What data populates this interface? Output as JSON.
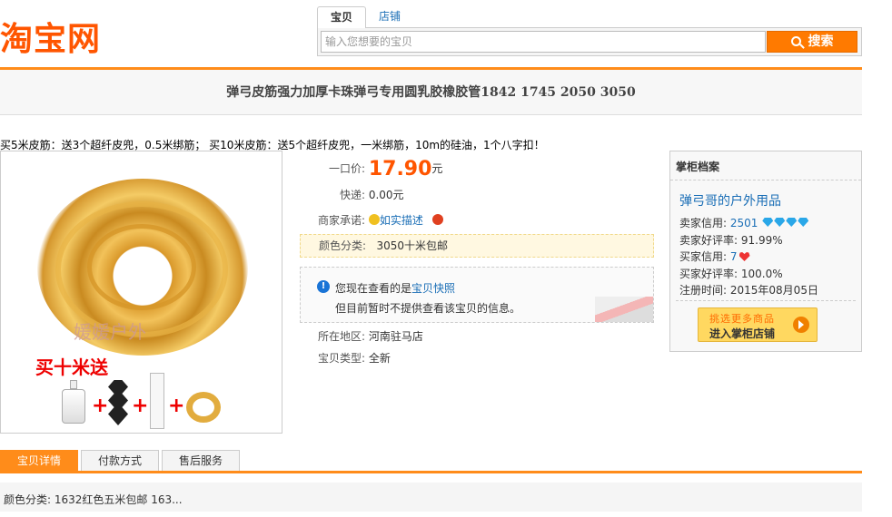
{
  "header": {
    "logo": "淘宝网",
    "search_tabs": [
      "宝贝",
      "店铺"
    ],
    "search_placeholder": "输入您想要的宝贝",
    "search_button": "搜索"
  },
  "product": {
    "title": "弹弓皮筋强力加厚卡珠弹弓专用圆乳胶橡胶管1842 1745 2050 3050",
    "promo": "买5米皮筋：送3个超纤皮兜，0.5米绑筋； 买10米皮筋：送5个超纤皮兜，一米绑筋，10m的硅油，1个八字扣！",
    "image_watermark": "媛媛户外",
    "image_caption": "买十米送",
    "price_label": "一口价:",
    "price": "17.90",
    "price_unit": "元",
    "shipping_label": "快递:",
    "shipping_value": "0.00元",
    "promise_label": "商家承诺:",
    "promise_value": "如实描述",
    "color_label": "颜色分类:",
    "color_value": "3050十米包邮",
    "notice_line1_prefix": "您现在查看的是",
    "notice_line1_link": "宝贝快照",
    "notice_line2": "但目前暂时不提供查看该宝贝的信息。",
    "location_label": "所在地区:",
    "location_value": "河南驻马店",
    "type_label": "宝贝类型:",
    "type_value": "全新"
  },
  "seller": {
    "heading": "掌柜档案",
    "shop_name": "弹弓哥的户外用品",
    "seller_credit_label": "卖家信用:",
    "seller_credit_value": "2501",
    "seller_rate_label": "卖家好评率:",
    "seller_rate_value": "91.99%",
    "buyer_credit_label": "买家信用:",
    "buyer_credit_value": "7",
    "buyer_rate_label": "买家好评率:",
    "buyer_rate_value": "100.0%",
    "reg_label": "注册时间:",
    "reg_value": "2015年08月05日",
    "button_line1": "挑选更多商品",
    "button_line2": "进入掌柜店铺"
  },
  "detail_tabs": [
    "宝贝详情",
    "付款方式",
    "售后服务"
  ],
  "detail_text": "颜色分类: 1632红色五米包邮 163..."
}
